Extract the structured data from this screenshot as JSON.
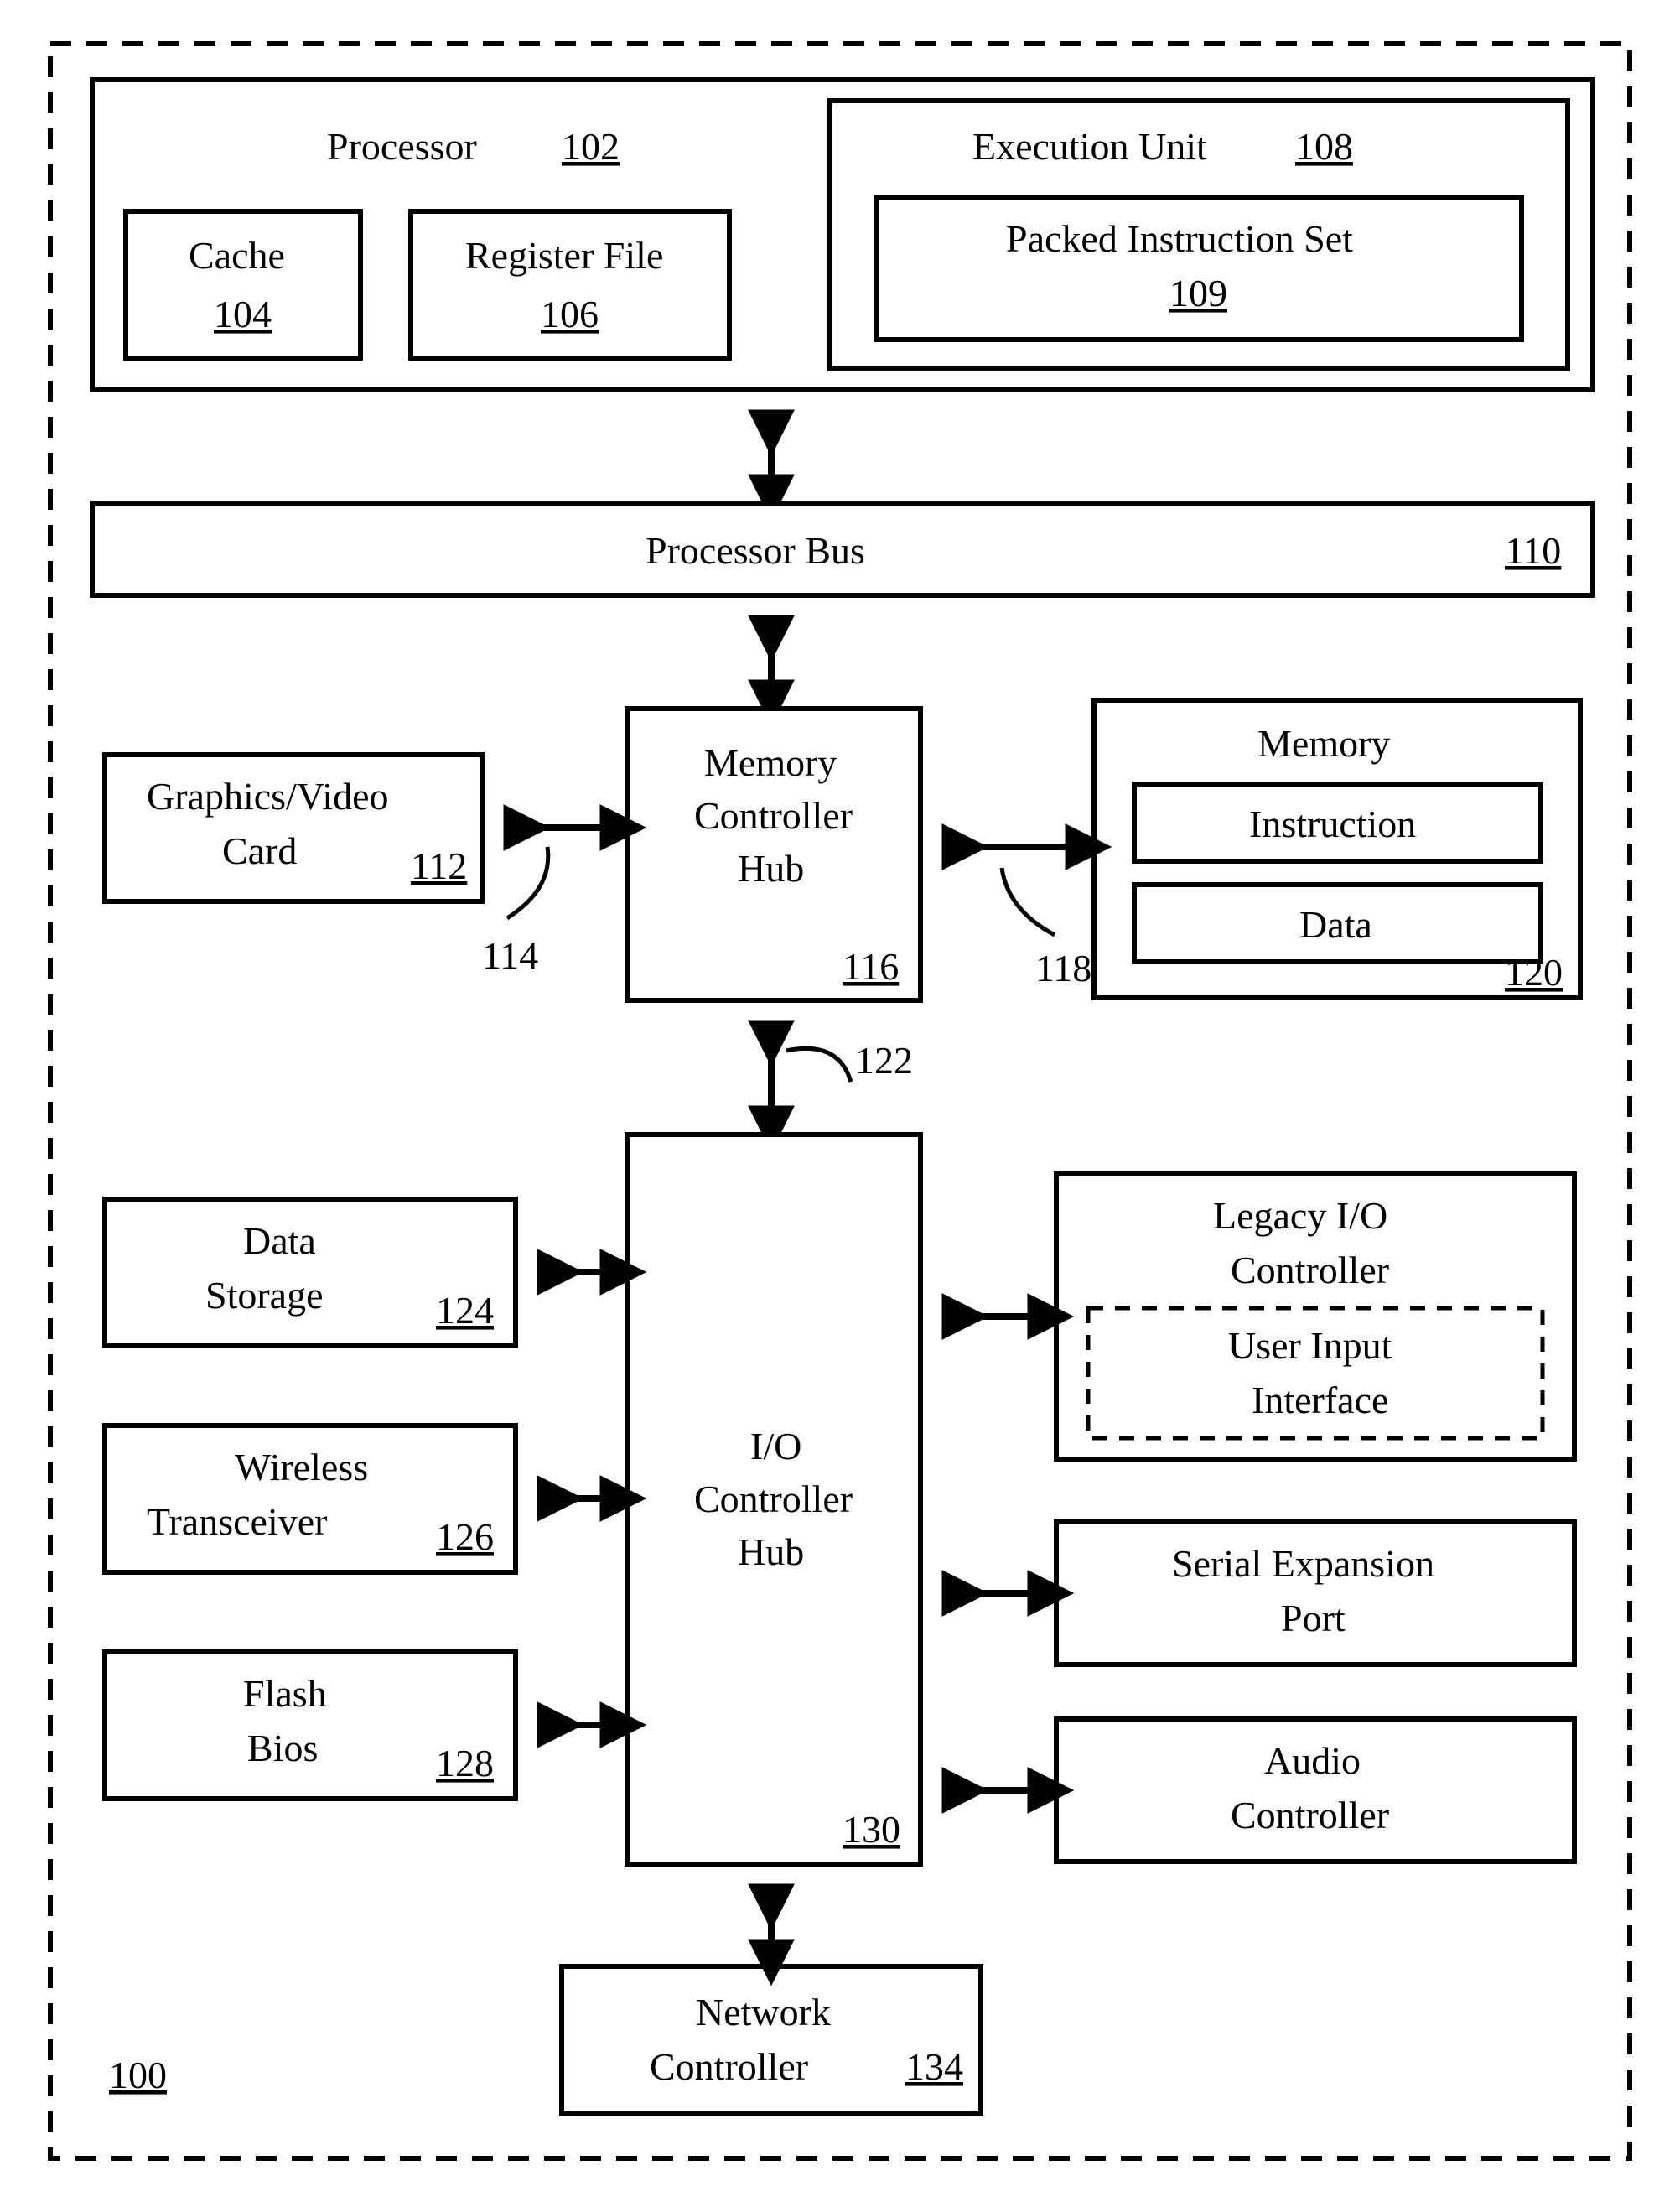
{
  "blocks": {
    "processor": {
      "label": "Processor",
      "ref": "102"
    },
    "cache": {
      "label": "Cache",
      "ref": "104"
    },
    "register_file": {
      "label": "Register File",
      "ref": "106"
    },
    "execution_unit": {
      "label": "Execution Unit",
      "ref": "108"
    },
    "packed_instruction_set": {
      "label": "Packed Instruction Set",
      "ref": "109"
    },
    "processor_bus": {
      "label": "Processor Bus",
      "ref": "110"
    },
    "graphics_video_card": {
      "line1": "Graphics/Video",
      "line2": "Card",
      "ref": "112"
    },
    "memory_controller_hub": {
      "line1": "Memory",
      "line2": "Controller",
      "line3": "Hub",
      "ref": "116"
    },
    "memory": {
      "label": "Memory",
      "ref": "120",
      "instruction": "Instruction",
      "data": "Data"
    },
    "io_controller_hub": {
      "line1": "I/O",
      "line2": "Controller",
      "line3": "Hub",
      "ref": "130"
    },
    "data_storage": {
      "line1": "Data",
      "line2": "Storage",
      "ref": "124"
    },
    "wireless_transceiver": {
      "line1": "Wireless",
      "line2": "Transceiver",
      "ref": "126"
    },
    "flash_bios": {
      "line1": "Flash",
      "line2": "Bios",
      "ref": "128"
    },
    "legacy_io_controller": {
      "line1": "Legacy I/O",
      "line2": "Controller"
    },
    "user_input_interface": {
      "line1": "User Input",
      "line2": "Interface"
    },
    "serial_expansion_port": {
      "line1": "Serial Expansion",
      "line2": "Port"
    },
    "audio_controller": {
      "line1": "Audio",
      "line2": "Controller"
    },
    "network_controller": {
      "line1": "Network",
      "line2": "Controller",
      "ref": "134"
    }
  },
  "labels": {
    "system_ref": "100",
    "link_114": "114",
    "link_118": "118",
    "link_122": "122"
  }
}
